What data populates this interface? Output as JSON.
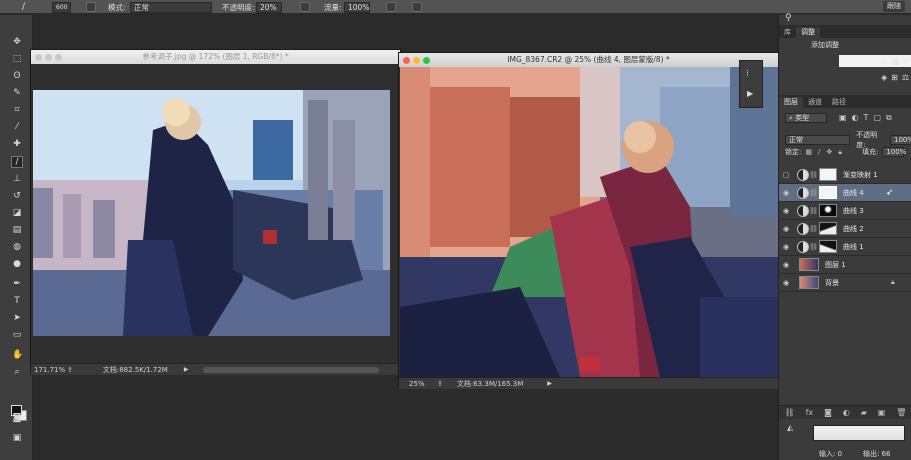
{
  "options_bar": {
    "brush_size": "600",
    "mode_label": "模式:",
    "mode_value": "正常",
    "opacity_label": "不透明度:",
    "opacity_value": "20%",
    "flow_label": "流量:",
    "flow_value": "100%",
    "badge": "跟随"
  },
  "doc_left": {
    "title": "参考调子.jpg @ 172% (图层 1, RGB/8*) *",
    "zoom": "171.71%",
    "file_size": "文档:882.5K/1.72M"
  },
  "doc_right": {
    "title": "IMG_8367.CR2 @ 25% (曲线 4, 图层蒙版/8) *",
    "zoom": "25%",
    "file_size": "文档:63.3M/165.3M"
  },
  "adjustments": {
    "tabs": [
      "库",
      "调整"
    ],
    "add_label": "添加调整"
  },
  "layers_panel": {
    "tabs": [
      "图层",
      "通道",
      "路径"
    ],
    "filter_kind": "类型",
    "blend_mode": "正常",
    "opacity_label": "不透明度:",
    "opacity_value": "100%",
    "lock_label": "锁定:",
    "fill_label": "填充:",
    "fill_value": "100%",
    "layers": [
      {
        "name": "渐变映射 1",
        "type": "adjustment",
        "mask": "white",
        "selected": false
      },
      {
        "name": "曲线 4",
        "type": "adjustment",
        "mask": "white",
        "selected": true
      },
      {
        "name": "曲线 3",
        "type": "adjustment",
        "mask": "dark",
        "selected": false
      },
      {
        "name": "曲线 2",
        "type": "adjustment",
        "mask": "mixed",
        "selected": false
      },
      {
        "name": "曲线 1",
        "type": "adjustment",
        "mask": "mixed",
        "selected": false
      },
      {
        "name": "图层 1",
        "type": "pixel",
        "selected": false
      },
      {
        "name": "背景",
        "type": "pixel",
        "selected": false
      }
    ]
  },
  "properties_strip": {
    "input_label": "输入:",
    "input_value": "0",
    "output_label": "输出:",
    "output_value": "66"
  },
  "colors": {
    "ps_dark": "#2b2b2b",
    "panel": "#3b3b3b",
    "selection": "#5f6e82"
  }
}
